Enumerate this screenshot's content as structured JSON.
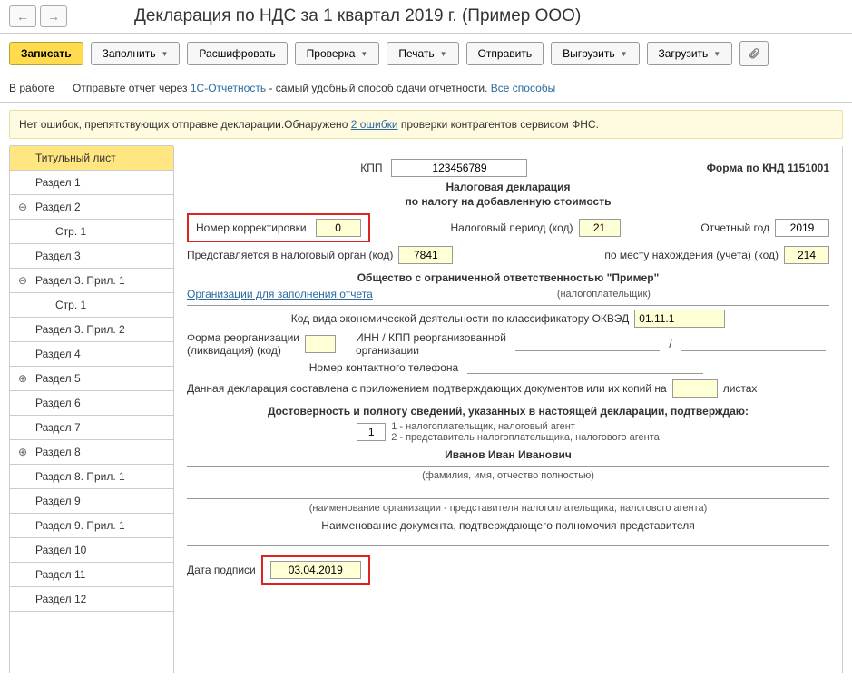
{
  "header": {
    "title": "Декларация по НДС за 1 квартал 2019 г. (Пример ООО)"
  },
  "toolbar": {
    "save": "Записать",
    "fill": "Заполнить",
    "decode": "Расшифровать",
    "check": "Проверка",
    "print": "Печать",
    "send": "Отправить",
    "upload": "Выгрузить",
    "download": "Загрузить"
  },
  "status": {
    "label": "В работе",
    "text1": "Отправьте отчет через ",
    "link1": "1С-Отчетность",
    "text2": " - самый удобный способ сдачи отчетности. ",
    "link2": "Все способы"
  },
  "warn": {
    "text1": "Нет ошибок, препятствующих отправке декларации.Обнаружено ",
    "link": "2 ошибки",
    "text2": " проверки контрагентов сервисом ФНС."
  },
  "side": [
    {
      "label": "Титульный лист",
      "sel": true
    },
    {
      "label": "Раздел 1"
    },
    {
      "label": "Раздел 2",
      "exp": "minus"
    },
    {
      "label": "Стр. 1",
      "sub": true
    },
    {
      "label": "Раздел 3"
    },
    {
      "label": "Раздел 3. Прил. 1",
      "exp": "minus"
    },
    {
      "label": "Стр. 1",
      "sub": true
    },
    {
      "label": "Раздел 3. Прил. 2"
    },
    {
      "label": "Раздел 4"
    },
    {
      "label": "Раздел 5",
      "exp": "plus"
    },
    {
      "label": "Раздел 6"
    },
    {
      "label": "Раздел 7"
    },
    {
      "label": "Раздел 8",
      "exp": "plus"
    },
    {
      "label": "Раздел 8. Прил. 1"
    },
    {
      "label": "Раздел 9"
    },
    {
      "label": "Раздел 9. Прил. 1"
    },
    {
      "label": "Раздел 10"
    },
    {
      "label": "Раздел 11"
    },
    {
      "label": "Раздел 12"
    }
  ],
  "form": {
    "kpp_label": "КПП",
    "kpp": "123456789",
    "knd": "Форма по КНД 1151001",
    "title1": "Налоговая декларация",
    "title2": "по налогу на добавленную стоимость",
    "corr_label": "Номер корректировки",
    "corr": "0",
    "period_label": "Налоговый период (код)",
    "period": "21",
    "year_label": "Отчетный год",
    "year": "2019",
    "to_org_label": "Представляется в налоговый орган (код)",
    "to_org": "7841",
    "place_label": "по месту нахождения (учета) (код)",
    "place": "214",
    "org_name": "Общество с ограниченной ответственностью \"Пример\"",
    "org_link": "Организации для заполнения отчета",
    "org_sub": "(налогоплательщик)",
    "okved_label": "Код вида экономической деятельности по классификатору ОКВЭД",
    "okved": "01.11.1",
    "reorg_label1": "Форма реорганизации",
    "reorg_label2": "(ликвидация) (код)",
    "reorg_inn_label1": "ИНН / КПП реорганизованной",
    "reorg_inn_label2": "организации",
    "slash": "/",
    "phone_label": "Номер контактного телефона",
    "docs_label1": "Данная декларация составлена с приложением подтверждающих документов или их копий на",
    "docs_label2": "листах",
    "confirm_title": "Достоверность и полноту сведений, указанных в настоящей декларации, подтверждаю:",
    "confirm_val": "1",
    "confirm_opt1": "1 - налогоплательщик, налоговый агент",
    "confirm_opt2": "2 - представитель налогоплательщика, налогового агента",
    "fio": "Иванов Иван Иванович",
    "fio_sub": "(фамилия, имя, отчество полностью)",
    "rep_sub": "(наименование организации - представителя налогоплательщика, налогового агента)",
    "doc_label": "Наименование документа, подтверждающего полномочия представителя",
    "sign_date_label": "Дата подписи",
    "sign_date": "03.04.2019"
  }
}
